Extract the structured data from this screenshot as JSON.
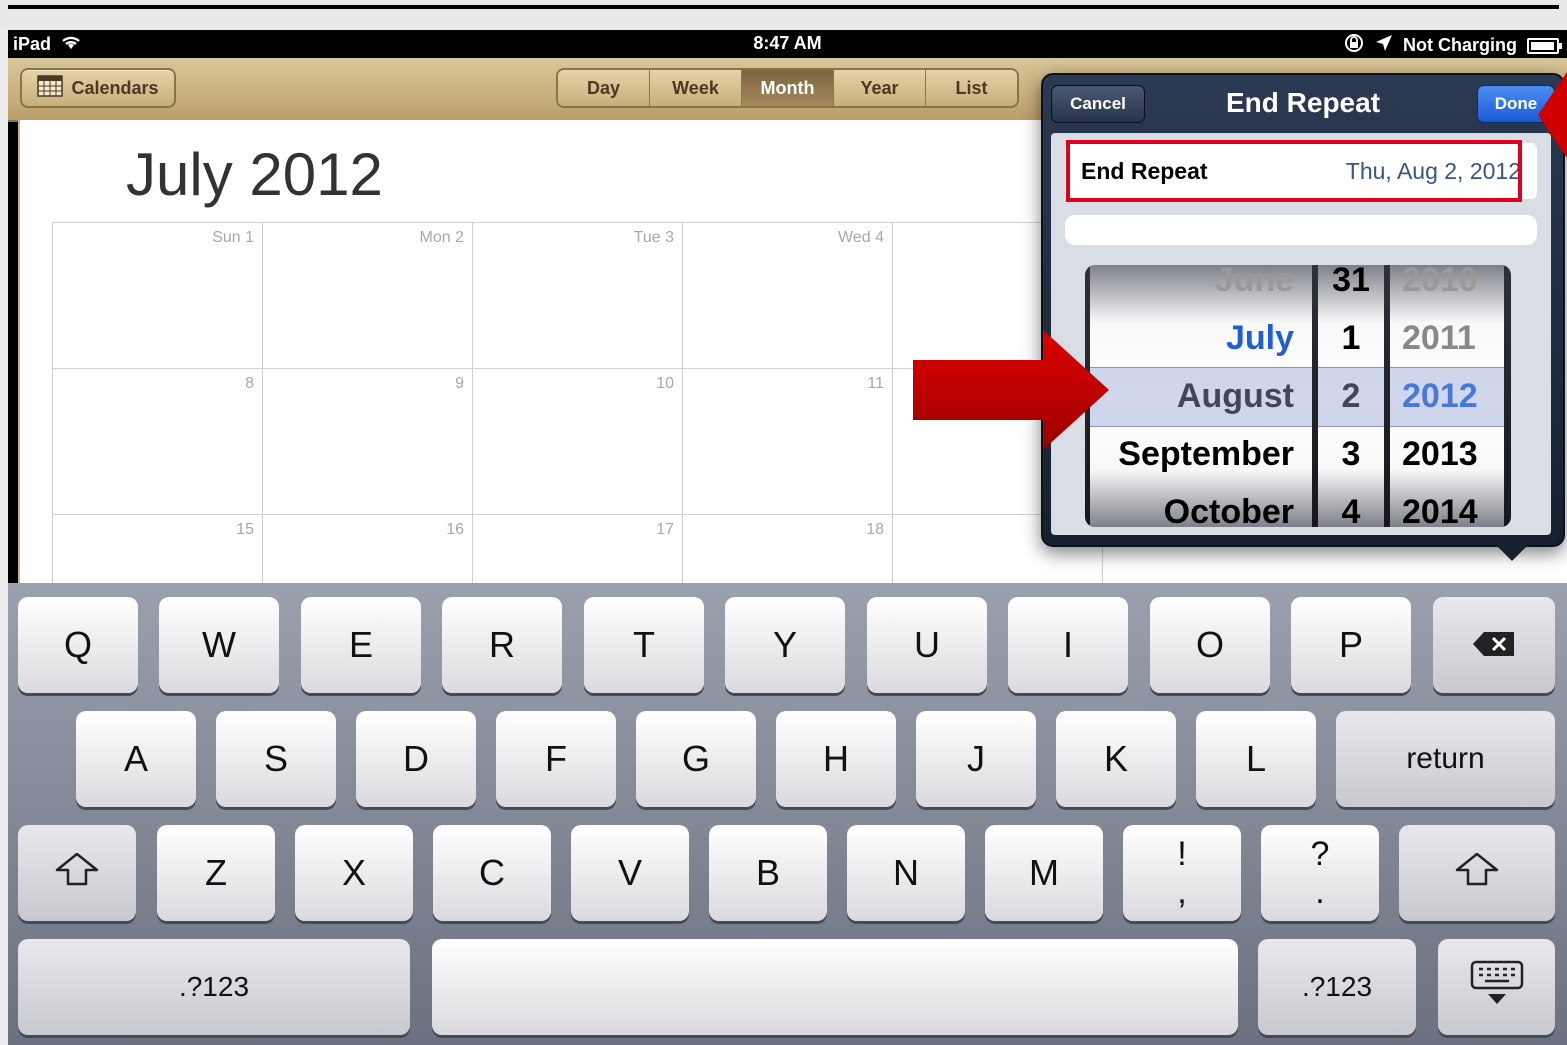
{
  "status_bar": {
    "device": "iPad",
    "time": "8:47 AM",
    "charging": "Not Charging"
  },
  "toolbar": {
    "calendars_label": "Calendars",
    "views": [
      "Day",
      "Week",
      "Month",
      "Year",
      "List"
    ],
    "active_view": "Month"
  },
  "calendar": {
    "month_title": "July 2012",
    "rows": [
      [
        "Sun 1",
        "Mon 2",
        "Tue 3",
        "Wed 4",
        ""
      ],
      [
        "8",
        "9",
        "10",
        "11",
        ""
      ],
      [
        "15",
        "16",
        "17",
        "18",
        ""
      ]
    ]
  },
  "popover": {
    "title": "End Repeat",
    "cancel_label": "Cancel",
    "done_label": "Done",
    "end_repeat_label": "End Repeat",
    "end_repeat_value": "Thu, Aug 2, 2012",
    "picker": {
      "months": [
        "June",
        "July",
        "August",
        "September",
        "October"
      ],
      "days": [
        "31",
        "1",
        "2",
        "3",
        "4"
      ],
      "years": [
        "2010",
        "2011",
        "2012",
        "2013",
        "2014"
      ],
      "selected_month": "August",
      "selected_day": "2",
      "selected_year": "2012"
    }
  },
  "keyboard": {
    "row1": [
      "Q",
      "W",
      "E",
      "R",
      "T",
      "Y",
      "U",
      "I",
      "O",
      "P"
    ],
    "row2": [
      "A",
      "S",
      "D",
      "F",
      "G",
      "H",
      "J",
      "K",
      "L"
    ],
    "return_label": "return",
    "row3": [
      "Z",
      "X",
      "C",
      "V",
      "B",
      "N",
      "M"
    ],
    "punct1": [
      "!",
      ","
    ],
    "punct2": [
      "?",
      "."
    ],
    "numbers_label": ".?123"
  },
  "colors": {
    "highlight_red": "#e0001b",
    "selected_blue": "#1a5bd6",
    "picker_selected_text": "#2f6fe0"
  }
}
